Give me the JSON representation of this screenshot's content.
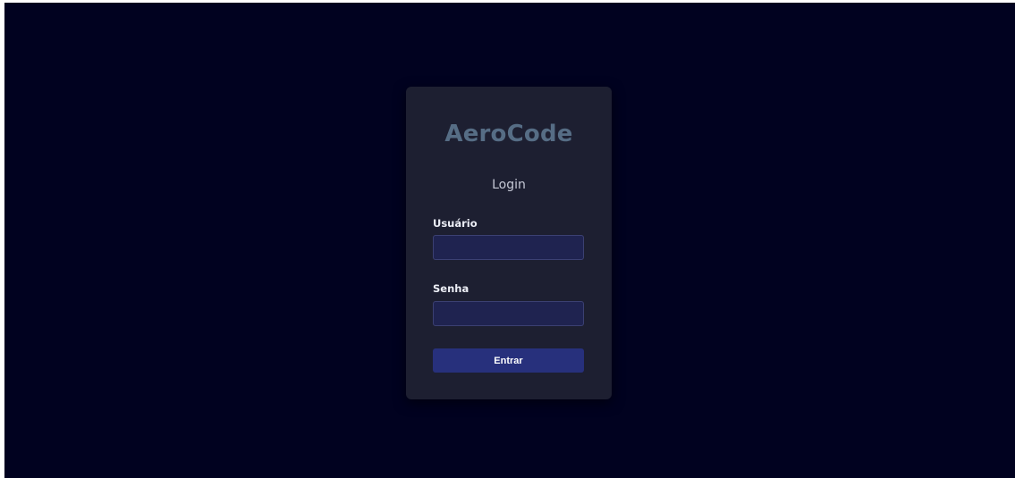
{
  "brand": {
    "title": "AeroCode"
  },
  "login": {
    "subtitle": "Login",
    "username": {
      "label": "Usuário",
      "value": "",
      "placeholder": ""
    },
    "password": {
      "label": "Senha",
      "value": "",
      "placeholder": ""
    },
    "submit_label": "Entrar"
  },
  "colors": {
    "page_background": "#010220",
    "card_background": "#1d1f31",
    "brand_text": "#566d85",
    "input_background": "#1f2350",
    "button_background": "#27307c"
  }
}
